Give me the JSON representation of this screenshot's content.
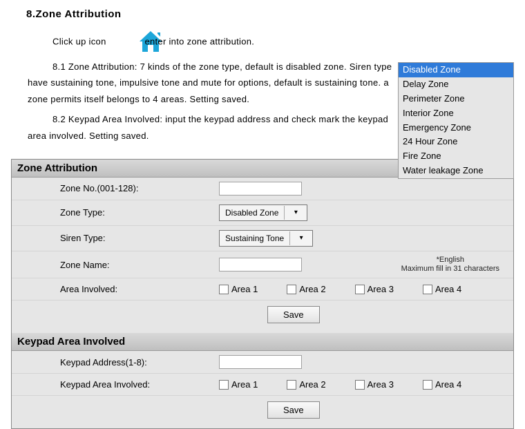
{
  "heading": "8.Zone Attribution",
  "intro_pre": "Click up icon",
  "intro_post": "enter into zone attribution.",
  "para81": "8.1 Zone Attribution: 7 kinds of the zone type, default is disabled zone. Siren type have sustaining tone, impulsive tone and mute for options, default is sustaining tone. a zone permits itself belongs to 4 areas. Setting saved.",
  "para82": "8.2 Keypad Area Involved: input the keypad address and check mark the keypad area involved. Setting saved.",
  "zone_types": [
    "Disabled Zone",
    "Delay Zone",
    "Perimeter Zone",
    "Interior Zone",
    "Emergency Zone",
    "24 Hour Zone",
    "Fire Zone",
    "Water leakage Zone"
  ],
  "panel1_title": "Zone Attribution",
  "panel2_title": "Keypad Area Involved",
  "labels": {
    "zone_no": "Zone No.(001-128):",
    "zone_type": "Zone Type:",
    "siren_type": "Siren Type:",
    "zone_name": "Zone Name:",
    "area_involved": "Area Involved:",
    "keypad_addr": "Keypad Address(1-8):",
    "keypad_area": "Keypad Area Involved:"
  },
  "selects": {
    "zone_type": "Disabled Zone",
    "siren_type": "Sustaining Tone"
  },
  "hint_line1": "*English",
  "hint_line2": "Maximum fill in 31 characters",
  "areas": [
    "Area 1",
    "Area 2",
    "Area 3",
    "Area 4"
  ],
  "save": "Save"
}
